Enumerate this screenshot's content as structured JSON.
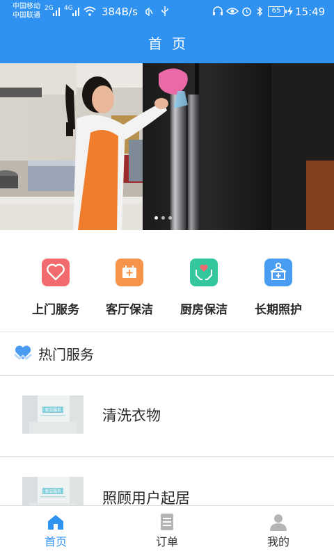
{
  "status_bar": {
    "carrier_1": "中国移动",
    "carrier_2": "中国联通",
    "sig_1": "2G",
    "sig_2": "4G",
    "net_speed": "384B/s",
    "battery": "65",
    "time": "15:49"
  },
  "header": {
    "title": "首页"
  },
  "banner": {
    "dots": 3,
    "active_dot": 1
  },
  "quick_services": [
    {
      "label": "上门服务",
      "icon": "heart-icon",
      "color": "#f16a6e"
    },
    {
      "label": "客厅保洁",
      "icon": "first-aid-kit-icon",
      "color": "#f5944a"
    },
    {
      "label": "厨房保洁",
      "icon": "heart-in-hands-icon",
      "color": "#32c79d"
    },
    {
      "label": "长期照护",
      "icon": "hospital-icon",
      "color": "#4a9cf3"
    }
  ],
  "hot_section": {
    "title": "热门服务",
    "icon": "handshake-heart-icon"
  },
  "services": [
    {
      "name": "清洗衣物",
      "thumb_text": "保洁服务"
    },
    {
      "name": "照顾用户起居",
      "thumb_text": "保洁服务"
    }
  ],
  "tabbar": [
    {
      "label": "首页",
      "icon": "home-icon",
      "active": true
    },
    {
      "label": "订单",
      "icon": "document-icon",
      "active": false
    },
    {
      "label": "我的",
      "icon": "user-icon",
      "active": false
    }
  ],
  "colors": {
    "primary": "#2f92f0",
    "text": "#2a2a2a",
    "divider": "#e2e2e2"
  }
}
